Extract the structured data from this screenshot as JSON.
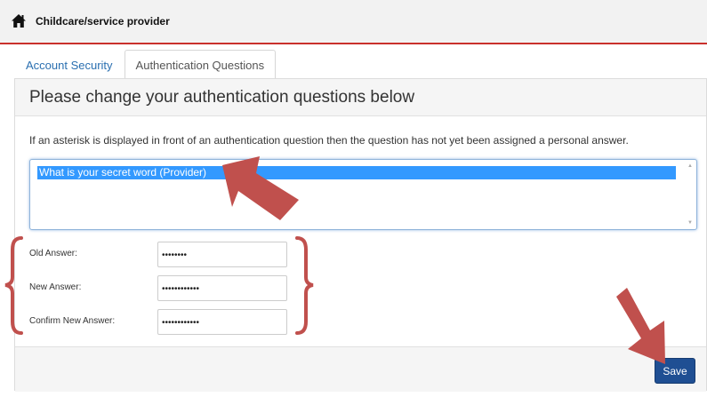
{
  "header": {
    "title": "Childcare/service provider"
  },
  "tabs": [
    {
      "label": "Account Security",
      "active": false
    },
    {
      "label": "Authentication Questions",
      "active": true
    }
  ],
  "panel": {
    "title": "Please change your authentication questions below",
    "instruction": "If an asterisk is displayed in front of an authentication question then the question has not yet been assigned a personal answer.",
    "questions": [
      {
        "label": "What is your secret word (Provider)",
        "selected": true
      }
    ]
  },
  "form": {
    "old_answer_label": "Old Answer:",
    "old_answer_value": "••••••••",
    "new_answer_label": "New Answer:",
    "new_answer_value": "••••••••••••",
    "confirm_answer_label": "Confirm New Answer:",
    "confirm_answer_value": "••••••••••••"
  },
  "footer": {
    "save_label": "Save"
  },
  "colors": {
    "accent_red": "#c9302c",
    "link_blue": "#2a6fb0",
    "selection_blue": "#3399ff",
    "button_blue": "#1f4f93",
    "annotation_red": "#c0504d"
  },
  "icons": {
    "home": "home-icon"
  }
}
